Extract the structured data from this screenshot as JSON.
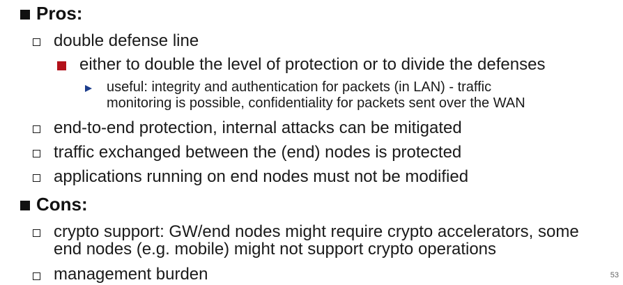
{
  "pros": {
    "heading": "Pros:",
    "items": [
      "double defense line",
      "either to double the level of protection or to divide the defenses",
      "useful: integrity and authentication for packets (in LAN) - traffic",
      "monitoring is possible, confidentiality for packets sent over the WAN",
      "end-to-end protection, internal attacks can be mitigated",
      "traffic exchanged between the (end) nodes is protected",
      "applications running on end nodes must not be modified"
    ]
  },
  "cons": {
    "heading": "Cons:",
    "items": [
      "crypto support: GW/end nodes might require crypto accelerators, some",
      "end nodes (e.g. mobile) might not support crypto operations",
      "management burden"
    ]
  },
  "page_number": "53",
  "colors": {
    "level3_bullet": "#b3111a",
    "level4_bullet": "#1c3d8c"
  }
}
